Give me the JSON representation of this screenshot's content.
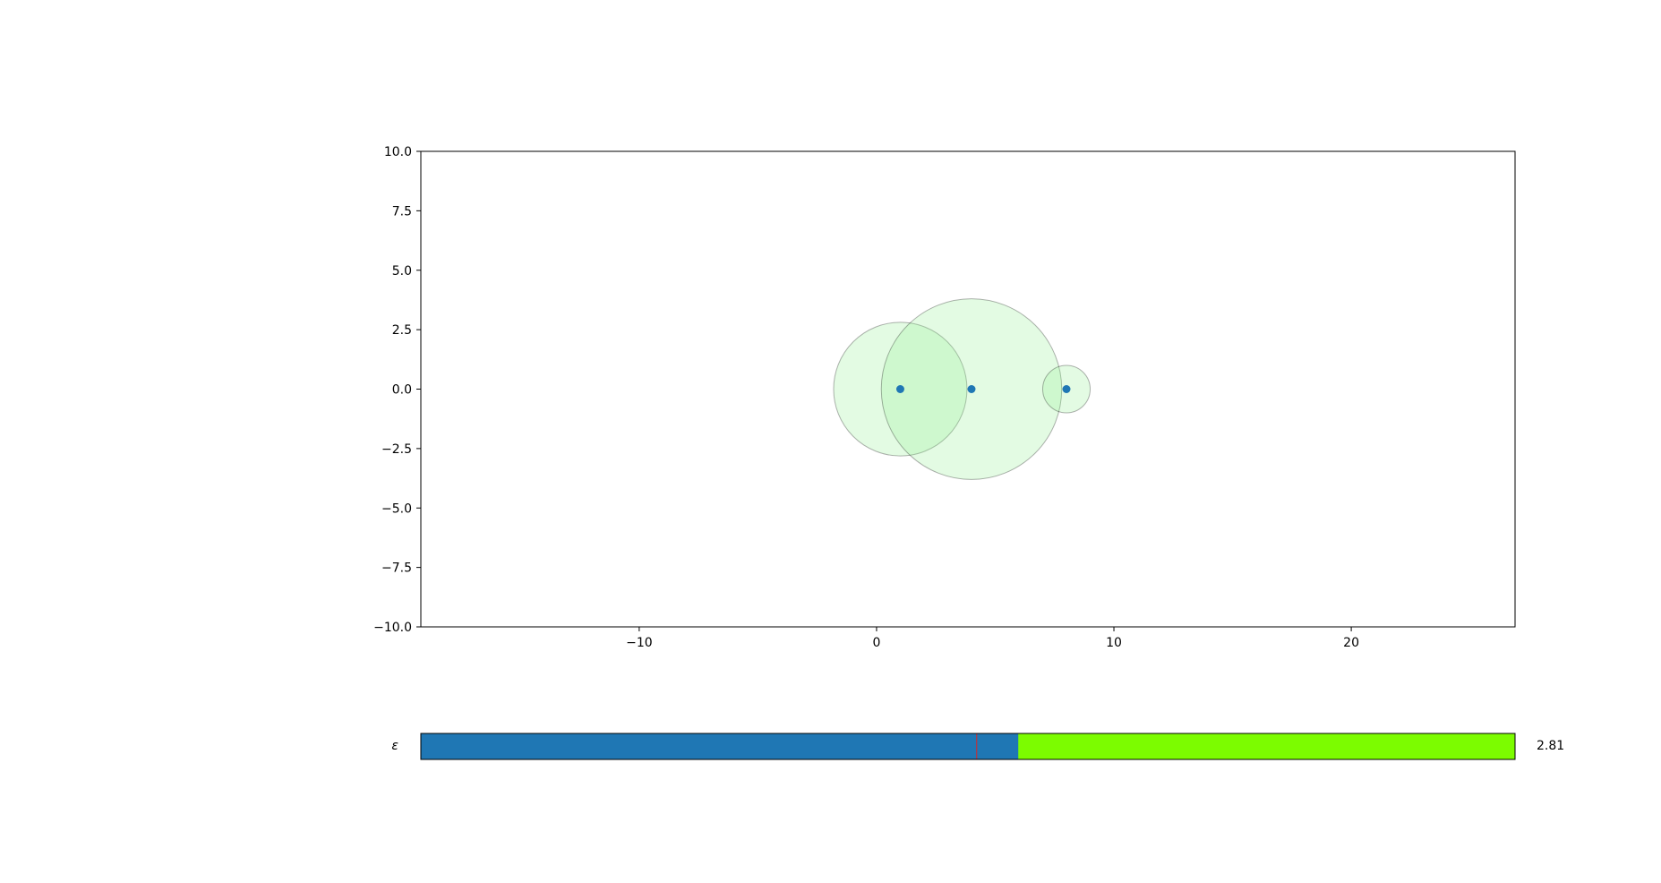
{
  "chart_data": {
    "type": "scatter",
    "title": "",
    "xlabel": "",
    "ylabel": "",
    "xlim": [
      -19.2,
      26.9
    ],
    "ylim": [
      -10,
      10
    ],
    "xticks": [
      -10,
      0,
      10,
      20
    ],
    "xtick_labels": [
      "−10",
      "0",
      "10",
      "20"
    ],
    "yticks": [
      10,
      7.5,
      5,
      2.5,
      0,
      -2.5,
      -5,
      -7.5,
      -10
    ],
    "ytick_labels": [
      "10.0",
      "7.5",
      "5.0",
      "2.5",
      "0.0",
      "−2.5",
      "−5.0",
      "−7.5",
      "−10.0"
    ],
    "grid": false,
    "points": [
      {
        "x": 1,
        "y": 0
      },
      {
        "x": 4,
        "y": 0
      },
      {
        "x": 8,
        "y": 0
      }
    ],
    "circles": [
      {
        "cx": 1,
        "cy": 0,
        "r": 2.81
      },
      {
        "cx": 4,
        "cy": 0,
        "r": 3.8
      },
      {
        "cx": 8,
        "cy": 0,
        "r": 1.0
      }
    ],
    "colors": {
      "point": "#1f77b4",
      "circle_fill": "#90ee90",
      "circle_edge": "#000000"
    }
  },
  "slider": {
    "label": "ε",
    "value_text": "2.81",
    "fill_fraction": 0.546,
    "init_marker_fraction": 0.508,
    "colors": {
      "fill": "#1f77b4",
      "track": "#7cfc00",
      "marker": "#d62728"
    }
  }
}
